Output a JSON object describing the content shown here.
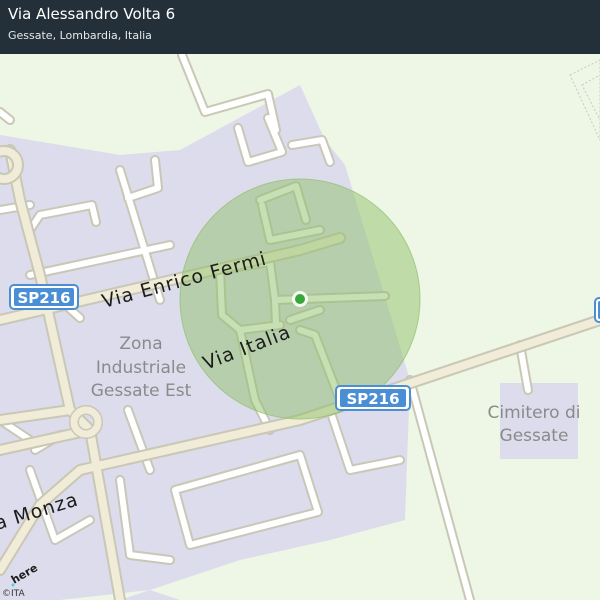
{
  "header": {
    "title": "Via Alessandro Volta 6",
    "subtitle": "Gessate, Lombardia, Italia"
  },
  "map": {
    "roads": {
      "via_enrico_fermi": "Via Enrico Fermi",
      "via_italia": "Via Italia",
      "via_monza": "a Monza"
    },
    "shields": {
      "left": "SP216",
      "center": "SP216"
    },
    "areas": {
      "zona_industriale": [
        "Zona",
        "Industriale",
        "Gessate Est"
      ],
      "cimitero": [
        "Cimitero di",
        "Gessate"
      ]
    },
    "attribution": {
      "logo": "here",
      "copyright": "©ITA"
    },
    "colors": {
      "background": "#eef6e6",
      "industrial_area": "#dcdcec",
      "road_fill": "#ffffff",
      "road_casing": "#c9c7b5",
      "major_road_fill": "#f1ecd8",
      "accuracy_circle": "#8fc06a",
      "location_dot": "#3aa63a",
      "shield_fill": "#4a8fd6",
      "header_bg": "#23303a"
    }
  }
}
